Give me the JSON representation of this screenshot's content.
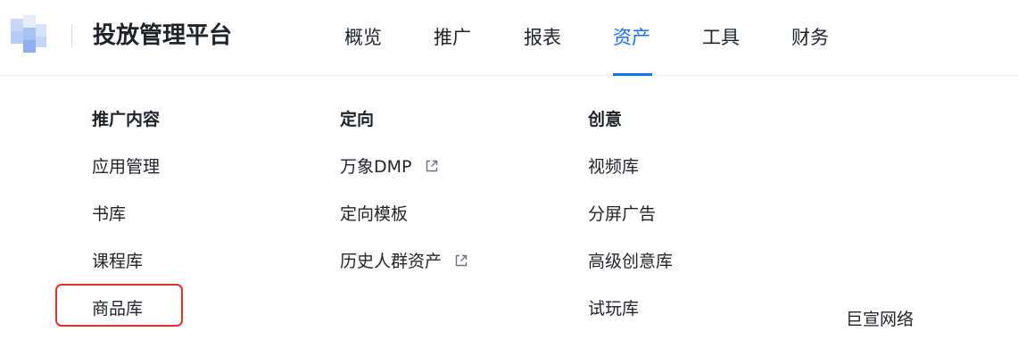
{
  "header": {
    "title": "投放管理平台",
    "nav": [
      {
        "label": "概览",
        "active": false
      },
      {
        "label": "推广",
        "active": false
      },
      {
        "label": "报表",
        "active": false
      },
      {
        "label": "资产",
        "active": true
      },
      {
        "label": "工具",
        "active": false
      },
      {
        "label": "财务",
        "active": false
      }
    ]
  },
  "menu": {
    "columns": [
      {
        "heading": "推广内容",
        "items": [
          {
            "label": "应用管理",
            "external": false
          },
          {
            "label": "书库",
            "external": false
          },
          {
            "label": "课程库",
            "external": false
          },
          {
            "label": "商品库",
            "external": false,
            "highlighted": true
          }
        ]
      },
      {
        "heading": "定向",
        "items": [
          {
            "label": "万象DMP",
            "external": true
          },
          {
            "label": "定向模板",
            "external": false
          },
          {
            "label": "历史人群资产",
            "external": true
          }
        ]
      },
      {
        "heading": "创意",
        "items": [
          {
            "label": "视频库",
            "external": false
          },
          {
            "label": "分屏广告",
            "external": false
          },
          {
            "label": "高级创意库",
            "external": false
          },
          {
            "label": "试玩库",
            "external": false
          }
        ]
      }
    ]
  },
  "watermark": "巨宣网络",
  "colors": {
    "accent": "#1a6dff",
    "highlight": "#e03131",
    "text": "#1f2329"
  },
  "icons": {
    "external_link": "external-link-icon"
  }
}
